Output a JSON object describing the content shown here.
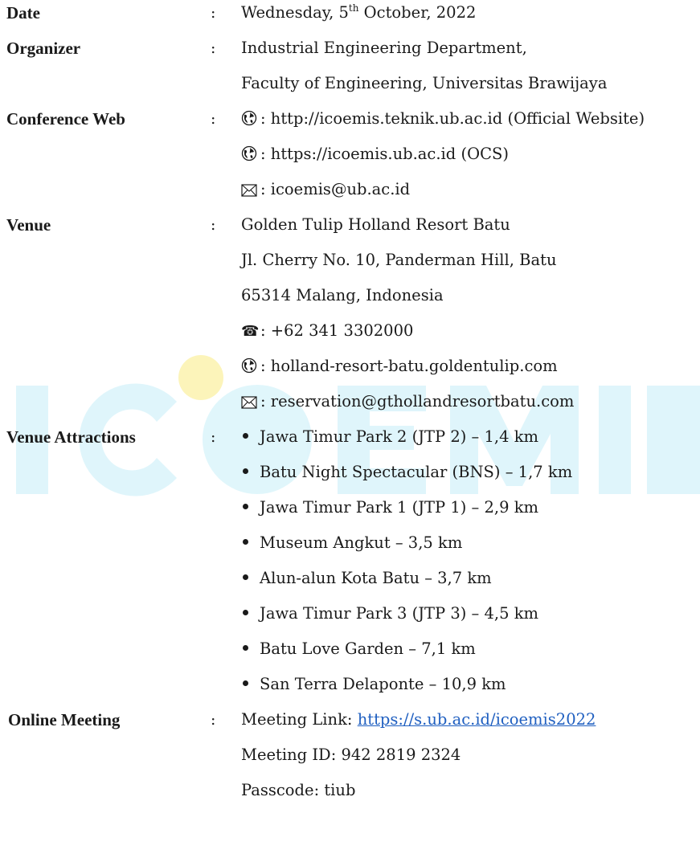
{
  "watermark": {
    "text": "ICOEMIS",
    "color": "#3cc4e8",
    "accent": "#f6e03a"
  },
  "date": {
    "label": "Date",
    "colon": ":",
    "weekday": "Wednesday, 5",
    "sup": "th",
    "rest": " October, 2022"
  },
  "organizer": {
    "label": "Organizer",
    "colon": ":",
    "lines": [
      "Industrial Engineering Department,",
      "Faculty of Engineering, Universitas Brawijaya"
    ]
  },
  "conference_web": {
    "label": "Conference Web",
    "colon": ":",
    "official_site": ": http://icoemis.teknik.ub.ac.id (Official Website)",
    "ocs_site": ": https://icoemis.ub.ac.id (OCS)",
    "email": ": icoemis@ub.ac.id",
    "icons": [
      "globe-icon",
      "globe-icon",
      "mail-icon"
    ]
  },
  "venue": {
    "label": "Venue",
    "colon": ":",
    "name": "Golden Tulip Holland Resort Batu",
    "street": "Jl. Cherry No. 10, Panderman Hill, Batu",
    "city": "65314 Malang, Indonesia",
    "phone": ": +62 341 3302000",
    "website": ": holland-resort-batu.goldentulip.com",
    "email": ": reservation@gthollandresortbatu.com",
    "icons": [
      "phone-icon",
      "globe-icon",
      "mail-icon"
    ]
  },
  "attractions": {
    "label": "Venue Attractions",
    "colon": ":",
    "items": [
      "Jawa Timur Park 2 (JTP 2) – 1,4 km",
      "Batu Night Spectacular (BNS) – 1,7 km",
      "Jawa Timur Park 1 (JTP 1) – 2,9 km",
      "Museum Angkut – 3,5 km",
      "Alun-alun Kota Batu – 3,7 km",
      "Jawa Timur Park 3 (JTP 3) – 4,5 km",
      "Batu Love Garden – 7,1 km",
      "San Terra Delaponte – 10,9 km"
    ]
  },
  "online_meeting": {
    "label": "Online Meeting",
    "colon": ":",
    "link_prefix": "Meeting Link: ",
    "link_text": "https://s.ub.ac.id/icoemis2022",
    "meeting_id": "Meeting ID: 942 2819 2324",
    "passcode": "Passcode: tiub"
  }
}
